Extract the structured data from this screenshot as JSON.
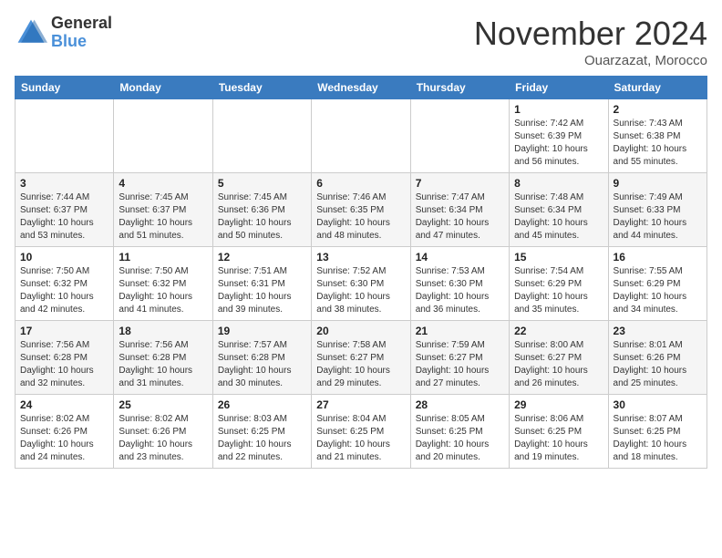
{
  "header": {
    "logo_general": "General",
    "logo_blue": "Blue",
    "month_title": "November 2024",
    "location": "Ouarzazat, Morocco"
  },
  "days_of_week": [
    "Sunday",
    "Monday",
    "Tuesday",
    "Wednesday",
    "Thursday",
    "Friday",
    "Saturday"
  ],
  "weeks": [
    [
      {
        "day": "",
        "info": ""
      },
      {
        "day": "",
        "info": ""
      },
      {
        "day": "",
        "info": ""
      },
      {
        "day": "",
        "info": ""
      },
      {
        "day": "",
        "info": ""
      },
      {
        "day": "1",
        "info": "Sunrise: 7:42 AM\nSunset: 6:39 PM\nDaylight: 10 hours and 56 minutes."
      },
      {
        "day": "2",
        "info": "Sunrise: 7:43 AM\nSunset: 6:38 PM\nDaylight: 10 hours and 55 minutes."
      }
    ],
    [
      {
        "day": "3",
        "info": "Sunrise: 7:44 AM\nSunset: 6:37 PM\nDaylight: 10 hours and 53 minutes."
      },
      {
        "day": "4",
        "info": "Sunrise: 7:45 AM\nSunset: 6:37 PM\nDaylight: 10 hours and 51 minutes."
      },
      {
        "day": "5",
        "info": "Sunrise: 7:45 AM\nSunset: 6:36 PM\nDaylight: 10 hours and 50 minutes."
      },
      {
        "day": "6",
        "info": "Sunrise: 7:46 AM\nSunset: 6:35 PM\nDaylight: 10 hours and 48 minutes."
      },
      {
        "day": "7",
        "info": "Sunrise: 7:47 AM\nSunset: 6:34 PM\nDaylight: 10 hours and 47 minutes."
      },
      {
        "day": "8",
        "info": "Sunrise: 7:48 AM\nSunset: 6:34 PM\nDaylight: 10 hours and 45 minutes."
      },
      {
        "day": "9",
        "info": "Sunrise: 7:49 AM\nSunset: 6:33 PM\nDaylight: 10 hours and 44 minutes."
      }
    ],
    [
      {
        "day": "10",
        "info": "Sunrise: 7:50 AM\nSunset: 6:32 PM\nDaylight: 10 hours and 42 minutes."
      },
      {
        "day": "11",
        "info": "Sunrise: 7:50 AM\nSunset: 6:32 PM\nDaylight: 10 hours and 41 minutes."
      },
      {
        "day": "12",
        "info": "Sunrise: 7:51 AM\nSunset: 6:31 PM\nDaylight: 10 hours and 39 minutes."
      },
      {
        "day": "13",
        "info": "Sunrise: 7:52 AM\nSunset: 6:30 PM\nDaylight: 10 hours and 38 minutes."
      },
      {
        "day": "14",
        "info": "Sunrise: 7:53 AM\nSunset: 6:30 PM\nDaylight: 10 hours and 36 minutes."
      },
      {
        "day": "15",
        "info": "Sunrise: 7:54 AM\nSunset: 6:29 PM\nDaylight: 10 hours and 35 minutes."
      },
      {
        "day": "16",
        "info": "Sunrise: 7:55 AM\nSunset: 6:29 PM\nDaylight: 10 hours and 34 minutes."
      }
    ],
    [
      {
        "day": "17",
        "info": "Sunrise: 7:56 AM\nSunset: 6:28 PM\nDaylight: 10 hours and 32 minutes."
      },
      {
        "day": "18",
        "info": "Sunrise: 7:56 AM\nSunset: 6:28 PM\nDaylight: 10 hours and 31 minutes."
      },
      {
        "day": "19",
        "info": "Sunrise: 7:57 AM\nSunset: 6:28 PM\nDaylight: 10 hours and 30 minutes."
      },
      {
        "day": "20",
        "info": "Sunrise: 7:58 AM\nSunset: 6:27 PM\nDaylight: 10 hours and 29 minutes."
      },
      {
        "day": "21",
        "info": "Sunrise: 7:59 AM\nSunset: 6:27 PM\nDaylight: 10 hours and 27 minutes."
      },
      {
        "day": "22",
        "info": "Sunrise: 8:00 AM\nSunset: 6:27 PM\nDaylight: 10 hours and 26 minutes."
      },
      {
        "day": "23",
        "info": "Sunrise: 8:01 AM\nSunset: 6:26 PM\nDaylight: 10 hours and 25 minutes."
      }
    ],
    [
      {
        "day": "24",
        "info": "Sunrise: 8:02 AM\nSunset: 6:26 PM\nDaylight: 10 hours and 24 minutes."
      },
      {
        "day": "25",
        "info": "Sunrise: 8:02 AM\nSunset: 6:26 PM\nDaylight: 10 hours and 23 minutes."
      },
      {
        "day": "26",
        "info": "Sunrise: 8:03 AM\nSunset: 6:25 PM\nDaylight: 10 hours and 22 minutes."
      },
      {
        "day": "27",
        "info": "Sunrise: 8:04 AM\nSunset: 6:25 PM\nDaylight: 10 hours and 21 minutes."
      },
      {
        "day": "28",
        "info": "Sunrise: 8:05 AM\nSunset: 6:25 PM\nDaylight: 10 hours and 20 minutes."
      },
      {
        "day": "29",
        "info": "Sunrise: 8:06 AM\nSunset: 6:25 PM\nDaylight: 10 hours and 19 minutes."
      },
      {
        "day": "30",
        "info": "Sunrise: 8:07 AM\nSunset: 6:25 PM\nDaylight: 10 hours and 18 minutes."
      }
    ]
  ]
}
